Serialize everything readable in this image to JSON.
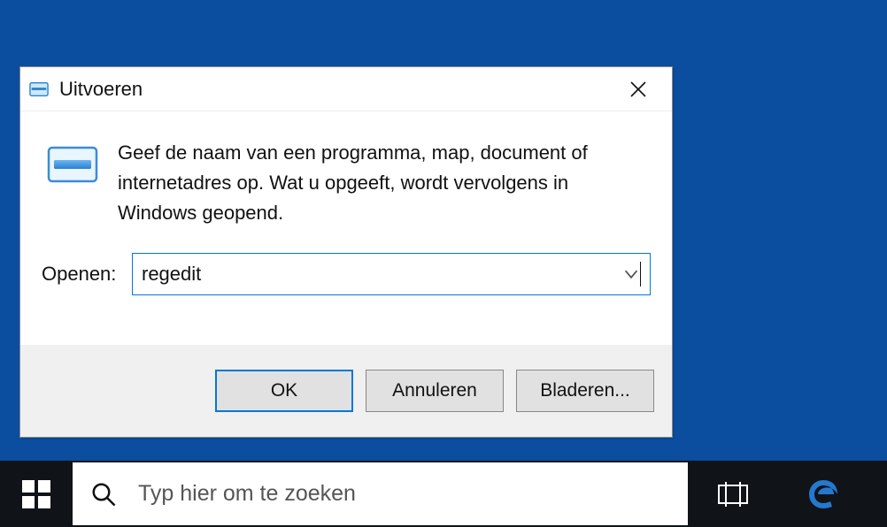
{
  "dialog": {
    "title": "Uitvoeren",
    "description": "Geef de naam van een programma, map, document of internetadres op. Wat u opgeeft, wordt vervolgens in Windows geopend.",
    "open_label": "Openen:",
    "input_value": "regedit",
    "buttons": {
      "ok": "OK",
      "cancel": "Annuleren",
      "browse": "Bladeren..."
    }
  },
  "taskbar": {
    "search_placeholder": "Typ hier om te zoeken"
  }
}
